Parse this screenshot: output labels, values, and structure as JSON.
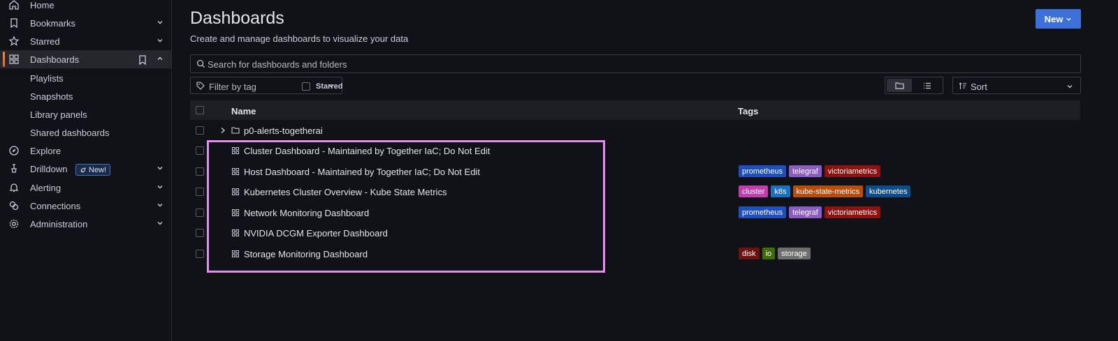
{
  "sidebar": {
    "items": [
      {
        "label": "Home"
      },
      {
        "label": "Bookmarks"
      },
      {
        "label": "Starred"
      },
      {
        "label": "Dashboards"
      },
      {
        "label": "Explore"
      },
      {
        "label": "Drilldown"
      },
      {
        "label": "Alerting"
      },
      {
        "label": "Connections"
      },
      {
        "label": "Administration"
      }
    ],
    "sub_items": [
      {
        "label": "Playlists"
      },
      {
        "label": "Snapshots"
      },
      {
        "label": "Library panels"
      },
      {
        "label": "Shared dashboards"
      }
    ],
    "new_badge": "New!"
  },
  "header": {
    "title": "Dashboards",
    "subtitle": "Create and manage dashboards to visualize your data",
    "new_button": "New"
  },
  "search": {
    "placeholder": "Search for dashboards and folders"
  },
  "filters": {
    "tag_filter": "Filter by tag",
    "starred": "Starred",
    "sort": "Sort"
  },
  "table": {
    "columns": {
      "name": "Name",
      "tags": "Tags"
    },
    "rows": [
      {
        "name": "p0-alerts-togetherai",
        "type": "folder",
        "tags": []
      },
      {
        "name": "Cluster Dashboard - Maintained by Together IaC; Do Not Edit",
        "type": "dashboard",
        "tags": []
      },
      {
        "name": "Host Dashboard - Maintained by Together IaC; Do Not Edit",
        "type": "dashboard",
        "tags": [
          {
            "label": "prometheus",
            "color": "#1f4fbf"
          },
          {
            "label": "telegraf",
            "color": "#8a5cc4"
          },
          {
            "label": "victoriametrics",
            "color": "#8f1212"
          }
        ]
      },
      {
        "name": "Kubernetes Cluster Overview - Kube State Metrics",
        "type": "dashboard",
        "tags": [
          {
            "label": "cluster",
            "color": "#c13eae"
          },
          {
            "label": "k8s",
            "color": "#1d6fbf"
          },
          {
            "label": "kube-state-metrics",
            "color": "#b84d0c"
          },
          {
            "label": "kubernetes",
            "color": "#0f4d8a"
          }
        ]
      },
      {
        "name": "Network Monitoring Dashboard",
        "type": "dashboard",
        "tags": [
          {
            "label": "prometheus",
            "color": "#1f4fbf"
          },
          {
            "label": "telegraf",
            "color": "#8a5cc4"
          },
          {
            "label": "victoriametrics",
            "color": "#8f1212"
          }
        ]
      },
      {
        "name": "NVIDIA DCGM Exporter Dashboard",
        "type": "dashboard",
        "tags": []
      },
      {
        "name": "Storage Monitoring Dashboard",
        "type": "dashboard",
        "tags": [
          {
            "label": "disk",
            "color": "#6b1212"
          },
          {
            "label": "io",
            "color": "#3f6b0a"
          },
          {
            "label": "storage",
            "color": "#6e6e6e"
          }
        ]
      }
    ]
  },
  "colors": {
    "accent": "#3d71d9",
    "highlight": "#e58ef0",
    "active_bar": "#ff8833"
  }
}
